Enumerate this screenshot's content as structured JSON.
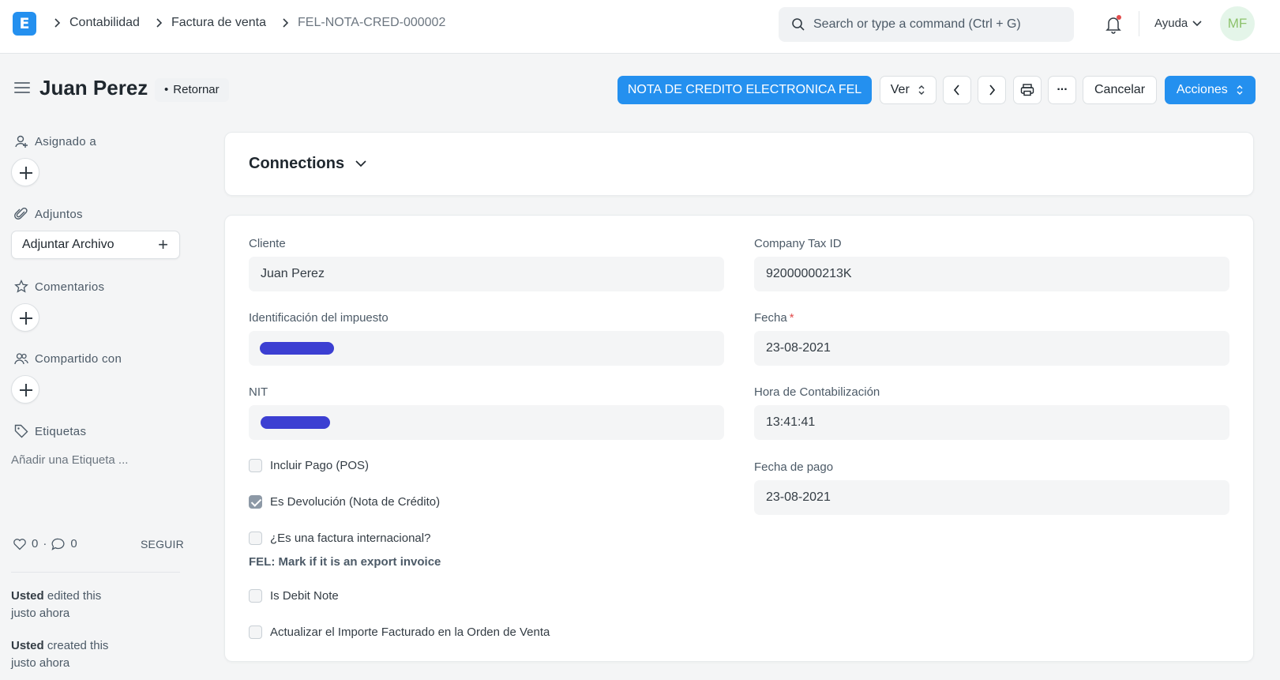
{
  "navbar": {
    "logo_letter": "E",
    "breadcrumbs": [
      "Contabilidad",
      "Factura de venta",
      "FEL-NOTA-CRED-000002"
    ],
    "search_placeholder": "Search or type a command (Ctrl + G)",
    "help_label": "Ayuda",
    "avatar_initials": "MF"
  },
  "header": {
    "title": "Juan Perez",
    "status": "Retornar",
    "fel_button": "NOTA DE CREDITO ELECTRONICA FEL",
    "view_button": "Ver",
    "more_button": "...",
    "cancel_button": "Cancelar",
    "actions_button": "Acciones"
  },
  "sidebar": {
    "assigned_to": "Asignado a",
    "attachments": "Adjuntos",
    "attach_file": "Adjuntar Archivo",
    "comments": "Comentarios",
    "shared_with": "Compartido con",
    "tags": "Etiquetas",
    "add_tag": "Añadir una Etiqueta ...",
    "likes": "0",
    "comment_count": "0",
    "follow": "SEGUIR",
    "timeline": [
      {
        "user": "Usted",
        "action": "edited this",
        "time": "justo ahora"
      },
      {
        "user": "Usted",
        "action": "created this",
        "time": "justo ahora"
      }
    ]
  },
  "connections": {
    "title": "Connections"
  },
  "form": {
    "cliente_label": "Cliente",
    "cliente_value": "Juan Perez",
    "tax_id_label": "Identificación del impuesto",
    "nit_label": "NIT",
    "company_tax_label": "Company Tax ID",
    "company_tax_value": "92000000213K",
    "fecha_label": "Fecha",
    "fecha_required": "*",
    "fecha_value": "23-08-2021",
    "hora_label": "Hora de Contabilización",
    "hora_value": "13:41:41",
    "fecha_pago_label": "Fecha de pago",
    "fecha_pago_value": "23-08-2021",
    "checkboxes": [
      {
        "label": "Incluir Pago (POS)",
        "checked": false
      },
      {
        "label": "Es Devolución (Nota de Crédito)",
        "checked": true
      },
      {
        "label": "¿Es una factura internacional?",
        "checked": false
      },
      {
        "label": "Is Debit Note",
        "checked": false
      },
      {
        "label": "Actualizar el Importe Facturado en la Orden de Venta",
        "checked": false
      }
    ],
    "export_help": "FEL: Mark if it is an export invoice"
  },
  "colors": {
    "primary": "#2490ef",
    "redaction": "#3c3fd2",
    "avatar_text": "#8dc26c"
  }
}
